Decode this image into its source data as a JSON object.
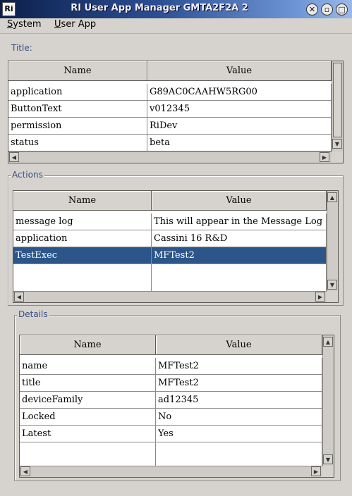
{
  "window": {
    "title": "RI User App Manager GMTA2F2A 2",
    "icon_label": "Ri"
  },
  "menu": {
    "items": [
      "System",
      "User App"
    ]
  },
  "title_section": {
    "label": "Title:",
    "columns": [
      "Name",
      "Value"
    ],
    "rows": [
      [
        "application",
        "G89AC0CAAHW5RG00"
      ],
      [
        "ButtonText",
        "v012345"
      ],
      [
        "permission",
        "RiDev"
      ],
      [
        "status",
        "beta"
      ]
    ]
  },
  "actions_section": {
    "label": "Actions",
    "columns": [
      "Name",
      "Value"
    ],
    "rows": [
      [
        "message log",
        "This will appear in the Message Log"
      ],
      [
        "application",
        "Cassini 16 R&D"
      ],
      [
        "TestExec",
        "MFTest2"
      ]
    ],
    "selected_row": "TestExec"
  },
  "details_section": {
    "label": "Details",
    "columns": [
      "Name",
      "Value"
    ],
    "rows": [
      [
        "name",
        "MFTest2"
      ],
      [
        "title",
        "MFTest2"
      ],
      [
        "deviceFamily",
        "ad12345"
      ],
      [
        "Locked",
        "No"
      ],
      [
        "Latest",
        "Yes"
      ]
    ]
  },
  "icons": {
    "close": "close-icon",
    "minimize": "minimize-icon",
    "maximize": "maximize-icon",
    "scroll_up": "scroll-up-icon",
    "scroll_down": "scroll-down-icon",
    "scroll_left": "scroll-left-icon",
    "scroll_right": "scroll-right-icon"
  },
  "colors": {
    "selection": "#2c568a",
    "group_label": "#3a4f83",
    "background": "#d6d3ce"
  }
}
